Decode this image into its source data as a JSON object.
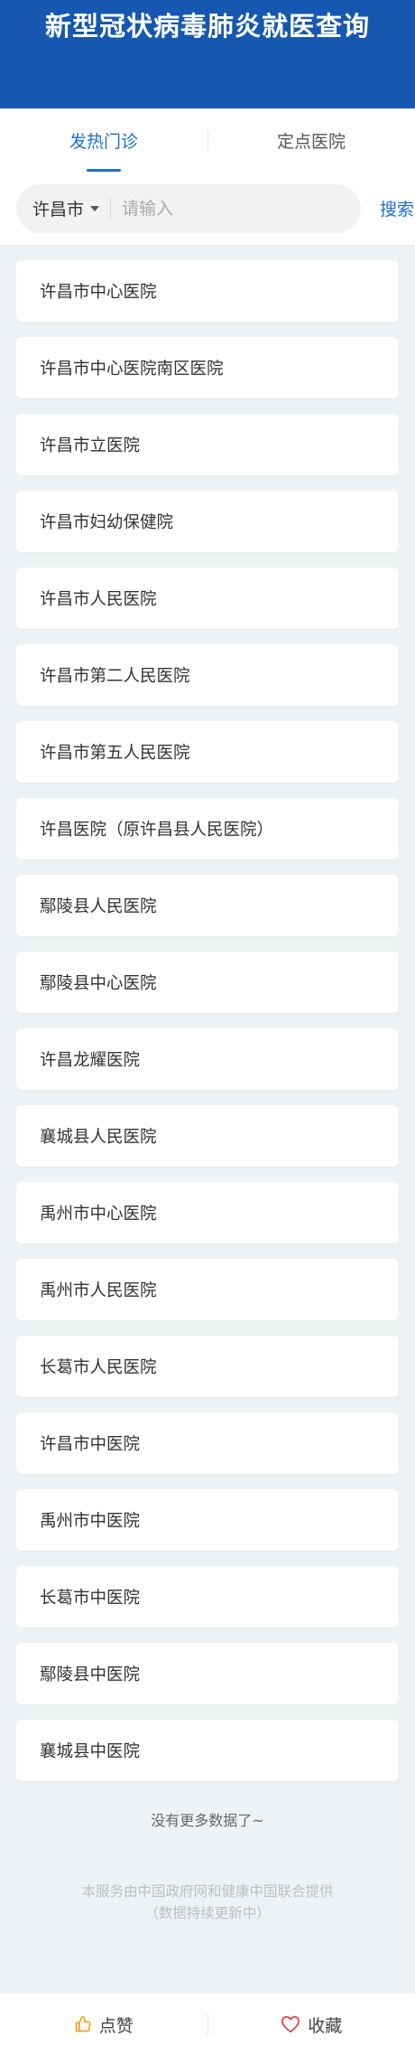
{
  "header": {
    "title": "新型冠状病毒肺炎就医查询"
  },
  "tabs": [
    {
      "label": "发热门诊",
      "active": true
    },
    {
      "label": "定点医院",
      "active": false
    }
  ],
  "search": {
    "city": "许昌市",
    "placeholder": "请输入",
    "value": "",
    "button_label": "搜索"
  },
  "hospitals": [
    "许昌市中心医院",
    "许昌市中心医院南区医院",
    "许昌市立医院",
    "许昌市妇幼保健院",
    "许昌市人民医院",
    "许昌市第二人民医院",
    "许昌市第五人民医院",
    "许昌医院（原许昌县人民医院）",
    "鄢陵县人民医院",
    "鄢陵县中心医院",
    "许昌龙耀医院",
    "襄城县人民医院",
    "禹州市中心医院",
    "禹州市人民医院",
    "长葛市人民医院",
    "许昌市中医院",
    "禹州市中医院",
    "长葛市中医院",
    "鄢陵县中医院",
    "襄城县中医院"
  ],
  "list_end_text": "没有更多数据了~",
  "footer": {
    "line1": "本服务由中国政府网和健康中国联合提供",
    "line2": "（数据持续更新中）"
  },
  "bottom_bar": {
    "like_label": "点赞",
    "favorite_label": "收藏",
    "like_icon_color": "#f0a020",
    "favorite_icon_color": "#e8444a"
  },
  "colors": {
    "header_bg": "#1658b0",
    "accent": "#1c6fd1",
    "page_bg": "#eef2f5"
  }
}
